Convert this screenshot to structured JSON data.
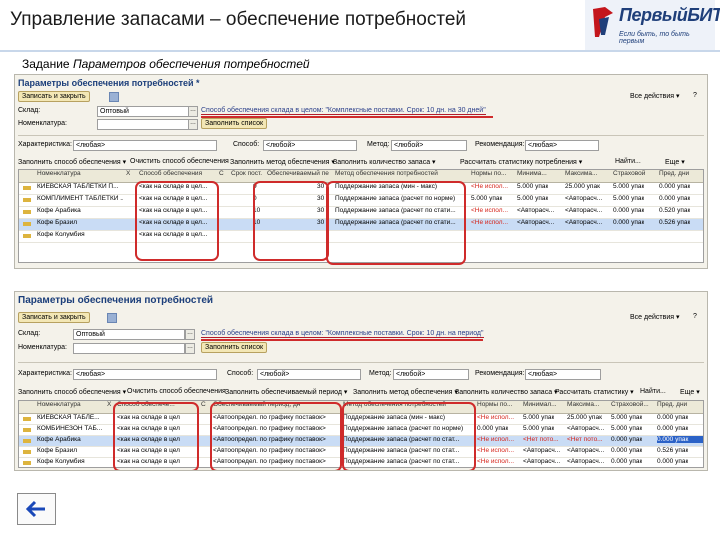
{
  "header": {
    "title": "Управление запасами – обеспечение потребностей",
    "logo_name": "ПервыйБИТ",
    "logo_tagline": "Если быть, то быть первым",
    "subtitle_prefix": "Задание",
    "subtitle_em": "Параметров обеспечения потребностей"
  },
  "colors": {
    "accent": "#cf2b2b",
    "link": "#2b3f8a",
    "button_bg": "#f3e7b5",
    "selection": "#c9dcf5"
  },
  "window1": {
    "title": "Параметры обеспечения потребностей *",
    "save_button": "Записать и закрыть",
    "all_actions": "Все действия ▾",
    "help": "?",
    "warehouse_label": "Склад:",
    "warehouse_value": "Оптовый",
    "wh_method": "Способ обеспечения склада в целом: \"Комплексные поставки. Срок: 10 дн. на 30 дней\"",
    "nomen_label": "Номенклатура:",
    "fill_button": "Заполнить список",
    "filters": {
      "kind_label": "Характеристика:",
      "kind_value": "<любая>",
      "way_label": "Способ:",
      "way_value": "<любой>",
      "method_label": "Метод:",
      "method_value": "<любой>",
      "recommend_label": "Рекомендация:",
      "recommend_value": "<любая>"
    },
    "actions": [
      "Заполнить способ обеспечения ▾",
      "Очистить способ обеспечения",
      "Заполнить метод обеспечения ▾",
      "Заполнить количество запаса ▾",
      "Рассчитать статистику потребления ▾",
      "Найти...",
      "Еще ▾"
    ],
    "table_headers": [
      "Номенклатура",
      "Х",
      "Способ обеспечения",
      "С",
      "Срок пост.",
      "Обеспечиваемый период",
      "Метод обеспечения потребностей",
      "Нормы по...",
      "Минима...",
      "Максима...",
      "Страховой",
      "Пред. дни"
    ],
    "rows": [
      [
        "КИЕВСКАЯ ТАБЛЕТКИ П...",
        "",
        "<как на складе в цел...",
        "",
        "0",
        "30",
        "Поддержание запаса (мин - макс)",
        "<Не испол...",
        "5.000 упак",
        "25.000 упак",
        "5.000 упак",
        "0.000 упак"
      ],
      [
        "КОМПЛИМЕНТ ТАБЛЕТКИ ...",
        "",
        "<как на складе в цел...",
        "",
        "0",
        "30",
        "Поддержание запаса (расчет по норме)",
        "5.000 упак",
        "5.000 упак",
        "<Авторасч...",
        "5.000 упак",
        "0.000 упак"
      ],
      [
        "Кофе Арабика",
        "",
        "<как на складе в цел...",
        "",
        "10",
        "30",
        "Поддержание запаса (расчет по стати...",
        "<Не испол...",
        "<Авторасч...",
        "<Авторасч...",
        "0.000 упак",
        "0.520 упак"
      ],
      [
        "Кофе Бразил",
        "",
        "<как на складе в цел...",
        "",
        "10",
        "30",
        "Поддержание запаса (расчет по стати...",
        "<Не испол...",
        "<Авторасч...",
        "<Авторасч...",
        "0.000 упак",
        "0.526 упак"
      ],
      [
        "Кофе Колумбия",
        "",
        "<как на складе в цел...",
        "",
        "",
        "",
        "",
        "",
        "",
        "",
        "",
        ""
      ]
    ]
  },
  "window2": {
    "title": "Параметры обеспечения потребностей",
    "save_button": "Записать и закрыть",
    "all_actions": "Все действия ▾",
    "help": "?",
    "warehouse_label": "Склад:",
    "warehouse_value": "Оптовый",
    "wh_method": "Способ обеспечения склада в целом: \"Комплексные поставки. Срок: 10 дн. на период\"",
    "nomen_label": "Номенклатура:",
    "fill_button": "Заполнить список",
    "filters": {
      "kind_label": "Характеристика:",
      "kind_value": "<любая>",
      "way_label": "Способ:",
      "way_value": "<любой>",
      "method_label": "Метод:",
      "method_value": "<любой>",
      "recommend_label": "Рекомендация:",
      "recommend_value": "<любая>"
    },
    "actions": [
      "Заполнить способ обеспечения ▾",
      "Очистить способ обеспечения",
      "Заполнить обеспечиваемый период ▾",
      "Заполнить метод обеспечения ▾",
      "Заполнить количество запаса ▾",
      "Рассчитать статистику ▾",
      "Найти...",
      "Еще ▾"
    ],
    "table_headers": [
      "Номенклатура",
      "Х",
      "Способ обеспече...",
      "С",
      "Обеспечиваемый период, дн",
      "Метод обеспечения потребностей",
      "Нормы по...",
      "Минимал...",
      "Максима...",
      "Страховой...",
      "Пред. дни"
    ],
    "rows": [
      [
        "КИЕВСКАЯ ТАБЛЕ...",
        "",
        "<как на складе в цел",
        "",
        "<Автоопредел. по графику поставок>",
        "Поддержание запаса (мин - макс)",
        "<Не испол...",
        "5.000 упак",
        "25.000 упак",
        "5.000 упак",
        "0.000 упак"
      ],
      [
        "КОМБИНЕЗОН ТАБ...",
        "",
        "<как на складе в цел",
        "",
        "<Автоопредел. по графику поставок>",
        "Поддержание запаса (расчет по норме)",
        "0.000 упак",
        "5.000 упак",
        "<Авторасч...",
        "5.000 упак",
        "0.000 упак"
      ],
      [
        "Кофе Арабика",
        "",
        "<как на складе в цел",
        "",
        "<Автоопредел. по графику поставок>",
        "Поддержание запаса (расчет по стат...",
        "<Не испол...",
        "<Нет пото...",
        "<Нет пото...",
        "0.000 упак",
        "0.000 упак"
      ],
      [
        "Кофе Бразил",
        "",
        "<как на складе в цел",
        "",
        "<Автоопредел. по графику поставок>",
        "Поддержание запаса (расчет по стат...",
        "<Не испол...",
        "<Авторасч...",
        "<Авторасч...",
        "0.000 упак",
        "0.526 упак"
      ],
      [
        "Кофе Колумбия",
        "",
        "<как на складе в цел",
        "",
        "<Автоопредел. по графику поставок>",
        "Поддержание запаса (расчет по стат...",
        "<Не испол...",
        "<Авторасч...",
        "<Авторасч...",
        "0.000 упак",
        "0.000 упак"
      ]
    ]
  },
  "back_button": {
    "icon": "arrow-left-icon"
  }
}
